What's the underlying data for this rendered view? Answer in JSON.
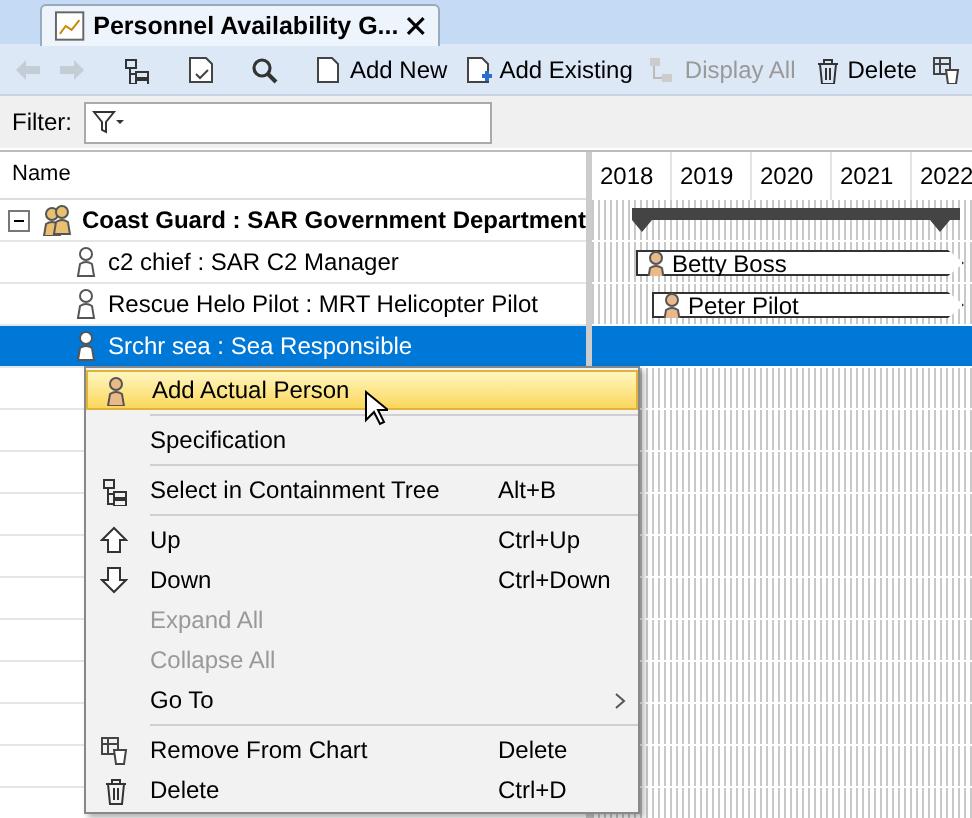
{
  "tab": {
    "title": "Personnel Availability G..."
  },
  "toolbar": {
    "nav": [
      {
        "disabled": true
      },
      {
        "disabled": true
      }
    ],
    "buttons": [
      {
        "label": "Add New",
        "disabled": false
      },
      {
        "label": "Add Existing",
        "disabled": false
      },
      {
        "label": "Display All",
        "disabled": true
      },
      {
        "label": "Delete",
        "disabled": false
      }
    ]
  },
  "filter": {
    "label": "Filter:"
  },
  "tree": {
    "column": "Name",
    "rows": [
      {
        "label": "Coast Guard : SAR Government Department",
        "expanded": true,
        "selected": false,
        "children": [
          {
            "label": "c2 chief : SAR C2 Manager",
            "selected": false,
            "bar": "Betty Boss"
          },
          {
            "label": "Rescue Helo Pilot : MRT Helicopter Pilot",
            "selected": false,
            "bar": "Peter Pilot"
          },
          {
            "label": "Srchr sea : Sea Responsible",
            "selected": true
          }
        ]
      }
    ]
  },
  "timeline": {
    "years": [
      "2018",
      "2019",
      "2020",
      "2021",
      "2022"
    ]
  },
  "context_menu": [
    {
      "kind": "item",
      "label": "Add Actual Person",
      "selected": true,
      "disabled": false
    },
    {
      "kind": "separator"
    },
    {
      "kind": "item",
      "label": "Specification",
      "selected": false,
      "disabled": false
    },
    {
      "kind": "separator"
    },
    {
      "kind": "item",
      "label": "Select in Containment Tree",
      "shortcut": "Alt+B",
      "selected": false,
      "disabled": false
    },
    {
      "kind": "separator"
    },
    {
      "kind": "item",
      "label": "Up",
      "shortcut": "Ctrl+Up",
      "selected": false,
      "disabled": false
    },
    {
      "kind": "item",
      "label": "Down",
      "shortcut": "Ctrl+Down",
      "selected": false,
      "disabled": false
    },
    {
      "kind": "item",
      "label": "Expand All",
      "selected": false,
      "disabled": true
    },
    {
      "kind": "item",
      "label": "Collapse All",
      "selected": false,
      "disabled": true
    },
    {
      "kind": "item",
      "label": "Go To",
      "selected": false,
      "disabled": false,
      "submenu": true
    },
    {
      "kind": "separator"
    },
    {
      "kind": "item",
      "label": "Remove From Chart",
      "shortcut": "Delete",
      "selected": false,
      "disabled": false
    },
    {
      "kind": "item",
      "label": "Delete",
      "shortcut": "Ctrl+D",
      "selected": false,
      "disabled": false
    }
  ]
}
